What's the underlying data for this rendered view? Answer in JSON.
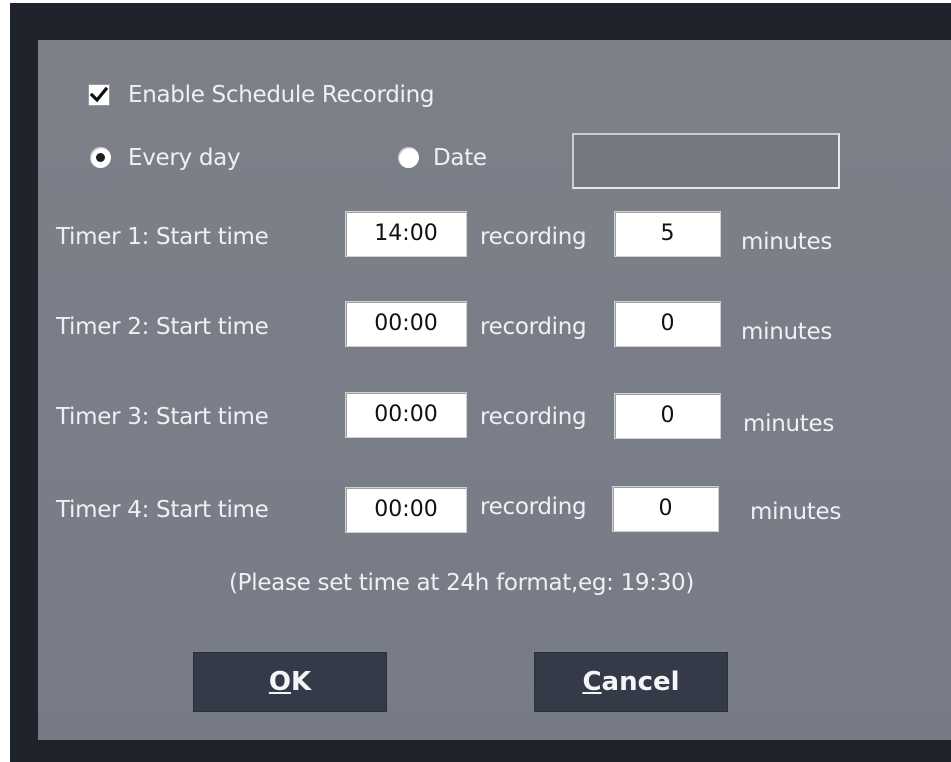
{
  "dialog": {
    "enable_schedule": {
      "label": "Enable Schedule Recording",
      "checked": true
    },
    "mode": {
      "every_day_label": "Every day",
      "date_label": "Date",
      "selected": "every_day"
    },
    "date_value": "",
    "timers": [
      {
        "label": "Timer 1: Start time",
        "start": "14:00",
        "recording_label": "recording",
        "duration": "5",
        "unit": "minutes"
      },
      {
        "label": "Timer 2: Start time",
        "start": "00:00",
        "recording_label": "recording",
        "duration": "0",
        "unit": "minutes"
      },
      {
        "label": "Timer 3: Start time",
        "start": "00:00",
        "recording_label": "recording",
        "duration": "0",
        "unit": "minutes"
      },
      {
        "label": "Timer 4: Start time",
        "start": "00:00",
        "recording_label": "recording",
        "duration": "0",
        "unit": "minutes"
      }
    ],
    "hint": "(Please set time at 24h format,eg: 19:30)",
    "ok_button": {
      "mnemonic": "O",
      "rest": "K"
    },
    "cancel_button": {
      "mnemonic": "C",
      "rest": "ancel"
    }
  }
}
